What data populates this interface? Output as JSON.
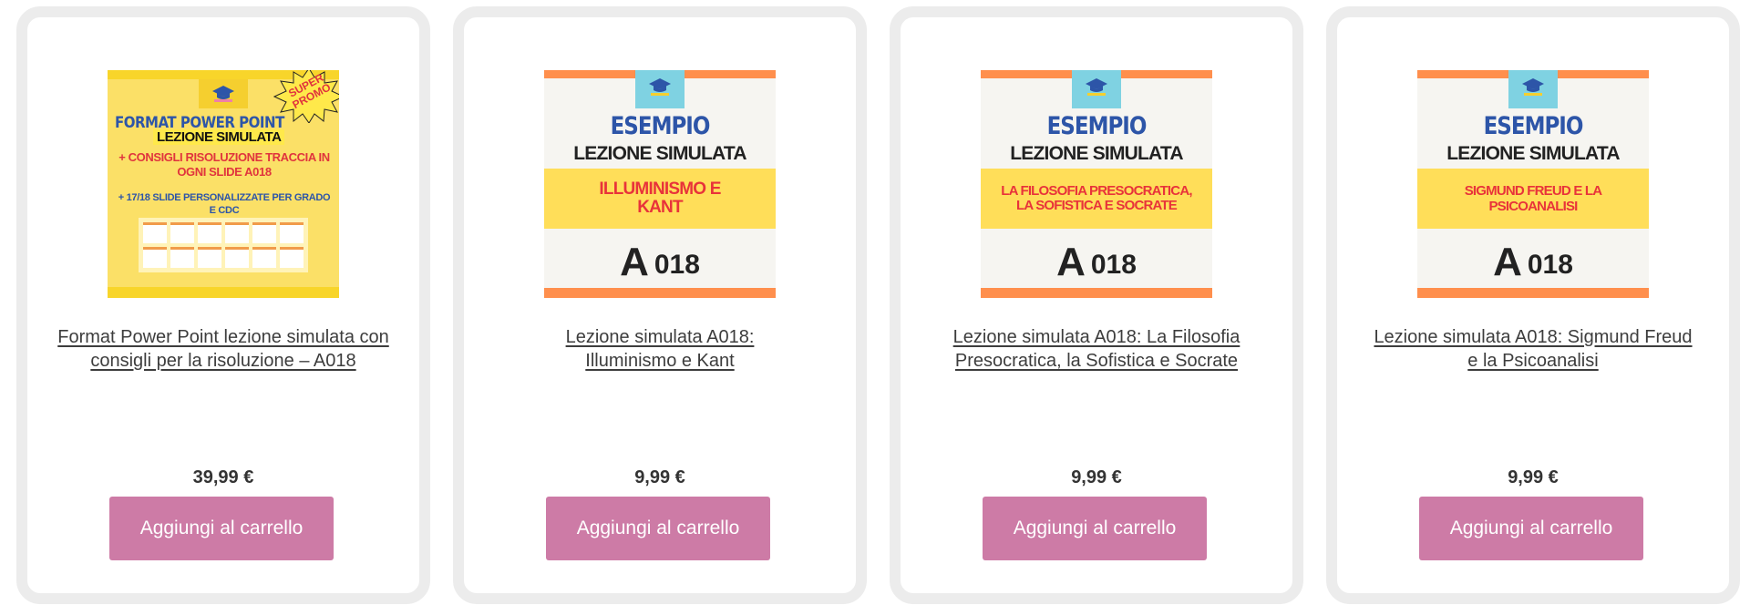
{
  "currency_note": "",
  "products": [
    {
      "title": "Format Power Point lezione simulata con consigli per la risoluzione – A018",
      "price": "39,99 €",
      "button_label": "Aggiungi al carrello",
      "thumb": {
        "line1": "FORMAT POWER POINT",
        "line2": "LEZIONE SIMULATA",
        "line3": "+ CONSIGLI RISOLUZIONE TRACCIA IN OGNI SLIDE A018",
        "line4": "+ 17/18 SLIDE PERSONALIZZATE PER GRADO E CDC",
        "badge": "SUPER PROMO"
      }
    },
    {
      "title": "Lezione simulata A018: Illuminismo e Kant",
      "price": "9,99 €",
      "button_label": "Aggiungi al carrello",
      "thumb": {
        "heading": "ESEMPIO",
        "subheading": "LEZIONE SIMULATA",
        "topic": "ILLUMINISMO E KANT",
        "class_letter": "A",
        "class_number": "018"
      }
    },
    {
      "title": "Lezione simulata A018: La Filosofia Presocratica, la Sofistica e Socrate",
      "price": "9,99 €",
      "button_label": "Aggiungi al carrello",
      "thumb": {
        "heading": "ESEMPIO",
        "subheading": "LEZIONE SIMULATA",
        "topic": "LA FILOSOFIA PRESOCRATICA, LA SOFISTICA E SOCRATE",
        "class_letter": "A",
        "class_number": "018"
      }
    },
    {
      "title": "Lezione simulata A018: Sigmund Freud e la Psicoanalisi",
      "price": "9,99 €",
      "button_label": "Aggiungi al carrello",
      "thumb": {
        "heading": "ESEMPIO",
        "subheading": "LEZIONE SIMULATA",
        "topic": "SIGMUND FREUD E LA PSICOANALISI",
        "class_letter": "A",
        "class_number": "018"
      }
    }
  ],
  "colors": {
    "button": "#cd7ba6",
    "card_border": "#ececec",
    "accent_orange": "#ff8f4d",
    "accent_yellow": "#ffde59",
    "accent_blue": "#2d55a8",
    "accent_red": "#e8333a"
  }
}
